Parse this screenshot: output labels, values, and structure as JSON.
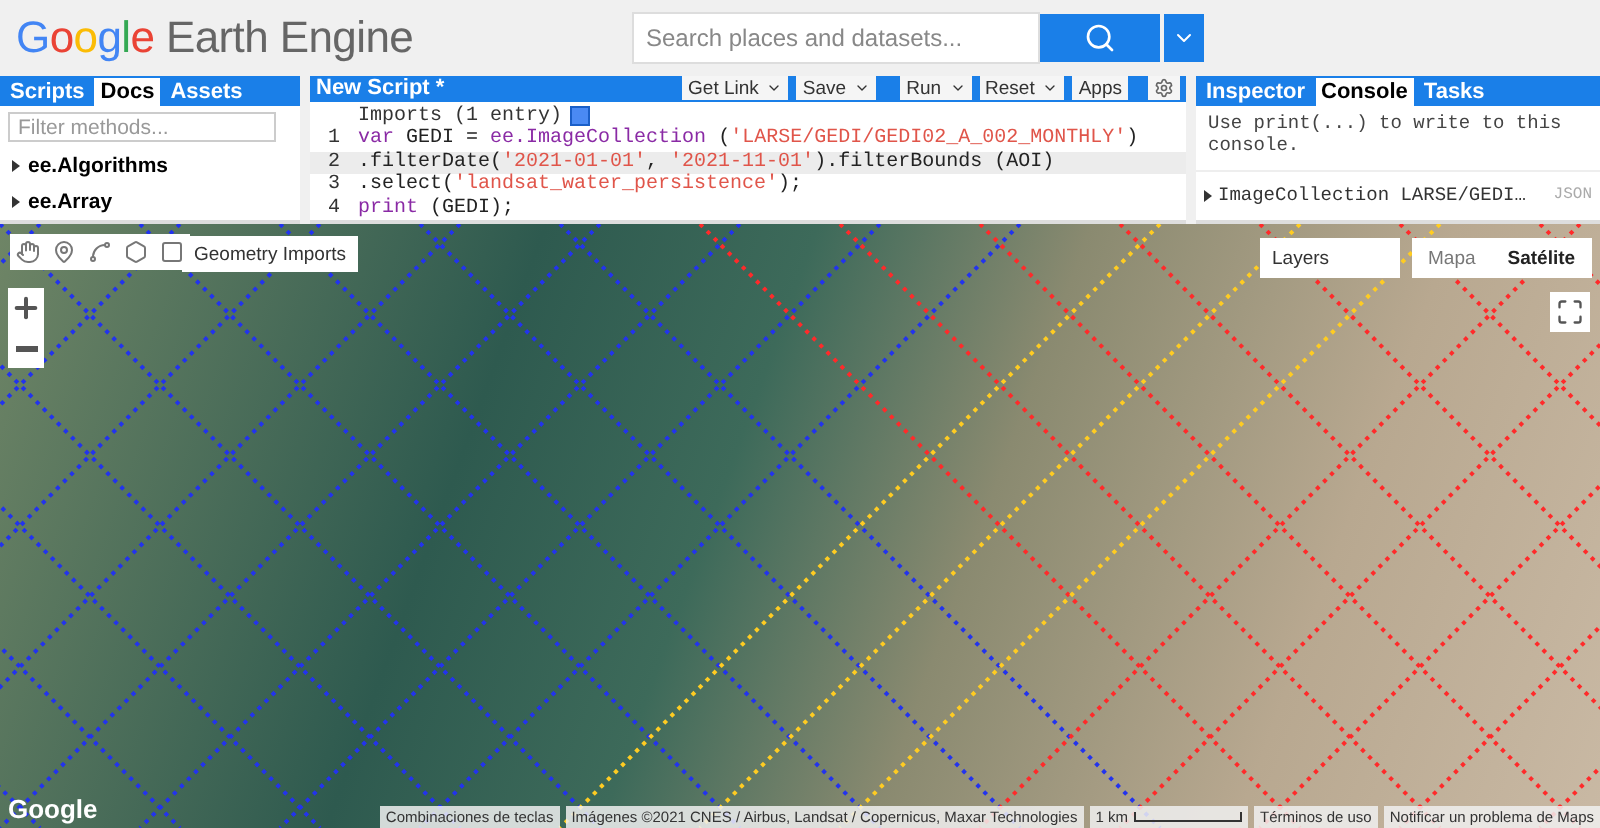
{
  "header": {
    "logo": {
      "brand": "Google",
      "product": "Earth Engine"
    },
    "search": {
      "placeholder": "Search places and datasets..."
    }
  },
  "left_panel": {
    "tabs": [
      {
        "label": "Scripts",
        "selected": false
      },
      {
        "label": "Docs",
        "selected": true
      },
      {
        "label": "Assets",
        "selected": false
      }
    ],
    "filter": {
      "placeholder": "Filter methods..."
    },
    "items": [
      {
        "label": "ee.Algorithms",
        "expanded": false
      },
      {
        "label": "ee.Array",
        "expanded": false
      }
    ]
  },
  "code_editor": {
    "title": "New Script *",
    "buttons": [
      {
        "label": "Get Link",
        "has_menu": true
      },
      {
        "label": "Save",
        "has_menu": true
      },
      {
        "label": "Run",
        "has_menu": true
      },
      {
        "label": "Reset",
        "has_menu": true
      },
      {
        "label": "Apps",
        "has_menu": false
      }
    ],
    "imports": "Imports (1 entry)",
    "lines": [
      {
        "number": "1",
        "current": false,
        "tokens": [
          {
            "kind": "keyword",
            "text": "var"
          },
          {
            "kind": "plain",
            "text": " GEDI = "
          },
          {
            "kind": "keyword",
            "text": "ee.ImageCollection"
          },
          {
            "kind": "plain",
            "text": " ("
          },
          {
            "kind": "string",
            "text": "'LARSE/GEDI/GEDI02_A_002_MONTHLY'"
          },
          {
            "kind": "plain",
            "text": ")"
          }
        ]
      },
      {
        "number": "2",
        "current": true,
        "tokens": [
          {
            "kind": "plain",
            "text": ".filterDate("
          },
          {
            "kind": "string",
            "text": "'2021-01-01'"
          },
          {
            "kind": "plain",
            "text": ", "
          },
          {
            "kind": "string",
            "text": "'2021-11-01'"
          },
          {
            "kind": "plain",
            "text": ").filterBounds (AOI)"
          }
        ]
      },
      {
        "number": "3",
        "current": false,
        "tokens": [
          {
            "kind": "plain",
            "text": ".select("
          },
          {
            "kind": "string",
            "text": "'landsat_water_persistence'"
          },
          {
            "kind": "plain",
            "text": ");"
          }
        ]
      },
      {
        "number": "4",
        "current": false,
        "tokens": [
          {
            "kind": "keyword",
            "text": "print"
          },
          {
            "kind": "plain",
            "text": " (GEDI);"
          }
        ]
      }
    ]
  },
  "right_panel": {
    "tabs": [
      {
        "label": "Inspector",
        "selected": false
      },
      {
        "label": "Console",
        "selected": true
      },
      {
        "label": "Tasks",
        "selected": false
      }
    ],
    "console_text": "Use print(...) to write to this console.",
    "entry": {
      "label": "ImageCollection LARSE/GEDI…",
      "json": "JSON",
      "expanded": false
    }
  },
  "map": {
    "geometry_imports": "Geometry Imports",
    "layers": "Layers",
    "map_types": [
      {
        "label": "Mapa",
        "selected": false
      },
      {
        "label": "Satélite",
        "selected": true
      }
    ],
    "google_logo": "Google",
    "footer": {
      "shortcuts": "Combinaciones de teclas",
      "attribution": "Imágenes ©2021 CNES / Airbus, Landsat / Copernicus, Maxar Technologies",
      "scale": "1 km",
      "terms": "Términos de uso",
      "report": "Notificar un problema de Maps"
    }
  }
}
